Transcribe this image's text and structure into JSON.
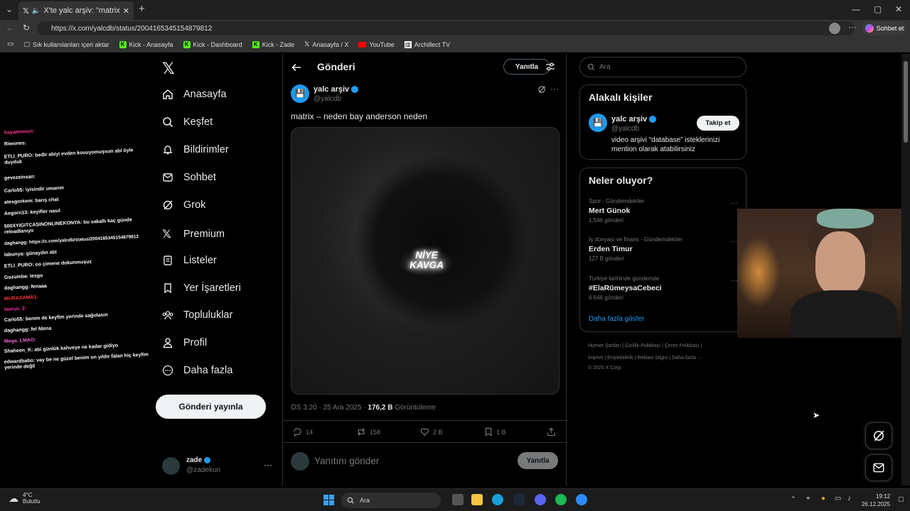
{
  "browser": {
    "tab_title": "X'te yalc arşiv: \"matrix – neden",
    "url": "https://x.com/yalcdb/status/2004165345154879812",
    "chat_button": "Sohbet et",
    "bookmarks": [
      "Sık kullanılanları içeri aktar",
      "Kick - Anasayfa",
      "Kick - Dashboard",
      "Kick - Zade",
      "Anasayfa / X",
      "YouTube",
      "Archillect TV"
    ]
  },
  "nav": {
    "items": [
      "Anasayfa",
      "Keşfet",
      "Bildirimler",
      "Sohbet",
      "Grok",
      "Premium",
      "Listeler",
      "Yer İşaretleri",
      "Topluluklar",
      "Profil",
      "Daha fazla"
    ],
    "post_button": "Gönderi yayınla",
    "me_name": "zade",
    "me_handle": "@zadekun"
  },
  "chat": [
    "hayalmmsvi:",
    "Riwones:",
    "ETLI_PURO: bedir abiyi evden kovuyomuşsun abi öyle duyduk",
    "gevezeinsan:",
    "Carlo55: iyisindir umarım",
    "atesgorkem: barış chat",
    "Aegorn13: keyifler nasıl",
    "500XYIGITCASINONLINEKONYA: bu sakallı kaç günde reloadlanıyo",
    "daghangg: https://x.com/yalcdb/status/2004165345154879812",
    "labunya: günaydın abi",
    "ETLI_PURO: oo çimene dokunmuşuz",
    "Gozumba: lesgo",
    "daghangg: fenaaa",
    "MURASAMA1:",
    "taurus_2:",
    "Carlo55: benim de keyfim yerinde sağolasın",
    "daghangg: fel fdena",
    "Mega_LMAO:",
    "Shaheen_K: abi günlük kahveye ne kadar gidiyo",
    "edwardbabo: vay be ne güzel benim on yıldır falan hiç keyfim yerinde değil"
  ],
  "post": {
    "header": "Gönderi",
    "reply_top": "Yanıtla",
    "author_name": "yalc arşiv",
    "author_handle": "@yalcdb",
    "text": "matrix – neden bay anderson neden",
    "media_caption": "NİYE KAVGA",
    "time": "ÖS 3:20 · 25 Ara 2025 · ",
    "views": "176,2 B",
    "views_label": " Görüntüleme",
    "replies": "14",
    "reposts": "158",
    "likes": "2 B",
    "bookmarks": "1 B",
    "reply_placeholder": "Yanıtını gönder",
    "reply_button": "Yanıtla"
  },
  "right": {
    "search_placeholder": "Ara",
    "who_title": "Alakalı kişiler",
    "who_name": "yalc arşiv",
    "who_handle": "@yalcdb",
    "who_bio": "video arşivi “database” isteklerinizi mention olarak atabilirsiniz",
    "follow": "Takip et",
    "trends_title": "Neler oluyor?",
    "trends": [
      {
        "cat": "Spor · Gündemdekiler",
        "name": "Mert Günok",
        "posts": "1.546 gönderi"
      },
      {
        "cat": "İş dünyası ve finans · Gündemdekiler",
        "name": "Erden Timur",
        "posts": "127 B gönderi"
      },
      {
        "cat": "Türkiye tarihinde gündemde",
        "name": "#ElaRümeysaCebeci",
        "posts": "4.646 gönderi"
      }
    ],
    "show_more": "Daha fazla göster",
    "footer1": "Hizmet Şartları  |  Gizlilik Politikası  |  Çerez Politikası  |",
    "footer2": "İmprint  |  Erişilebilirlik  |  Reklam bilgisi  |  Daha fazla ···",
    "footer3": "© 2025 X Corp."
  },
  "taskbar": {
    "temp": "4°C",
    "weather": "Bulutlu",
    "search": "Ara",
    "time": "19:12",
    "date": "26.12.2025"
  }
}
